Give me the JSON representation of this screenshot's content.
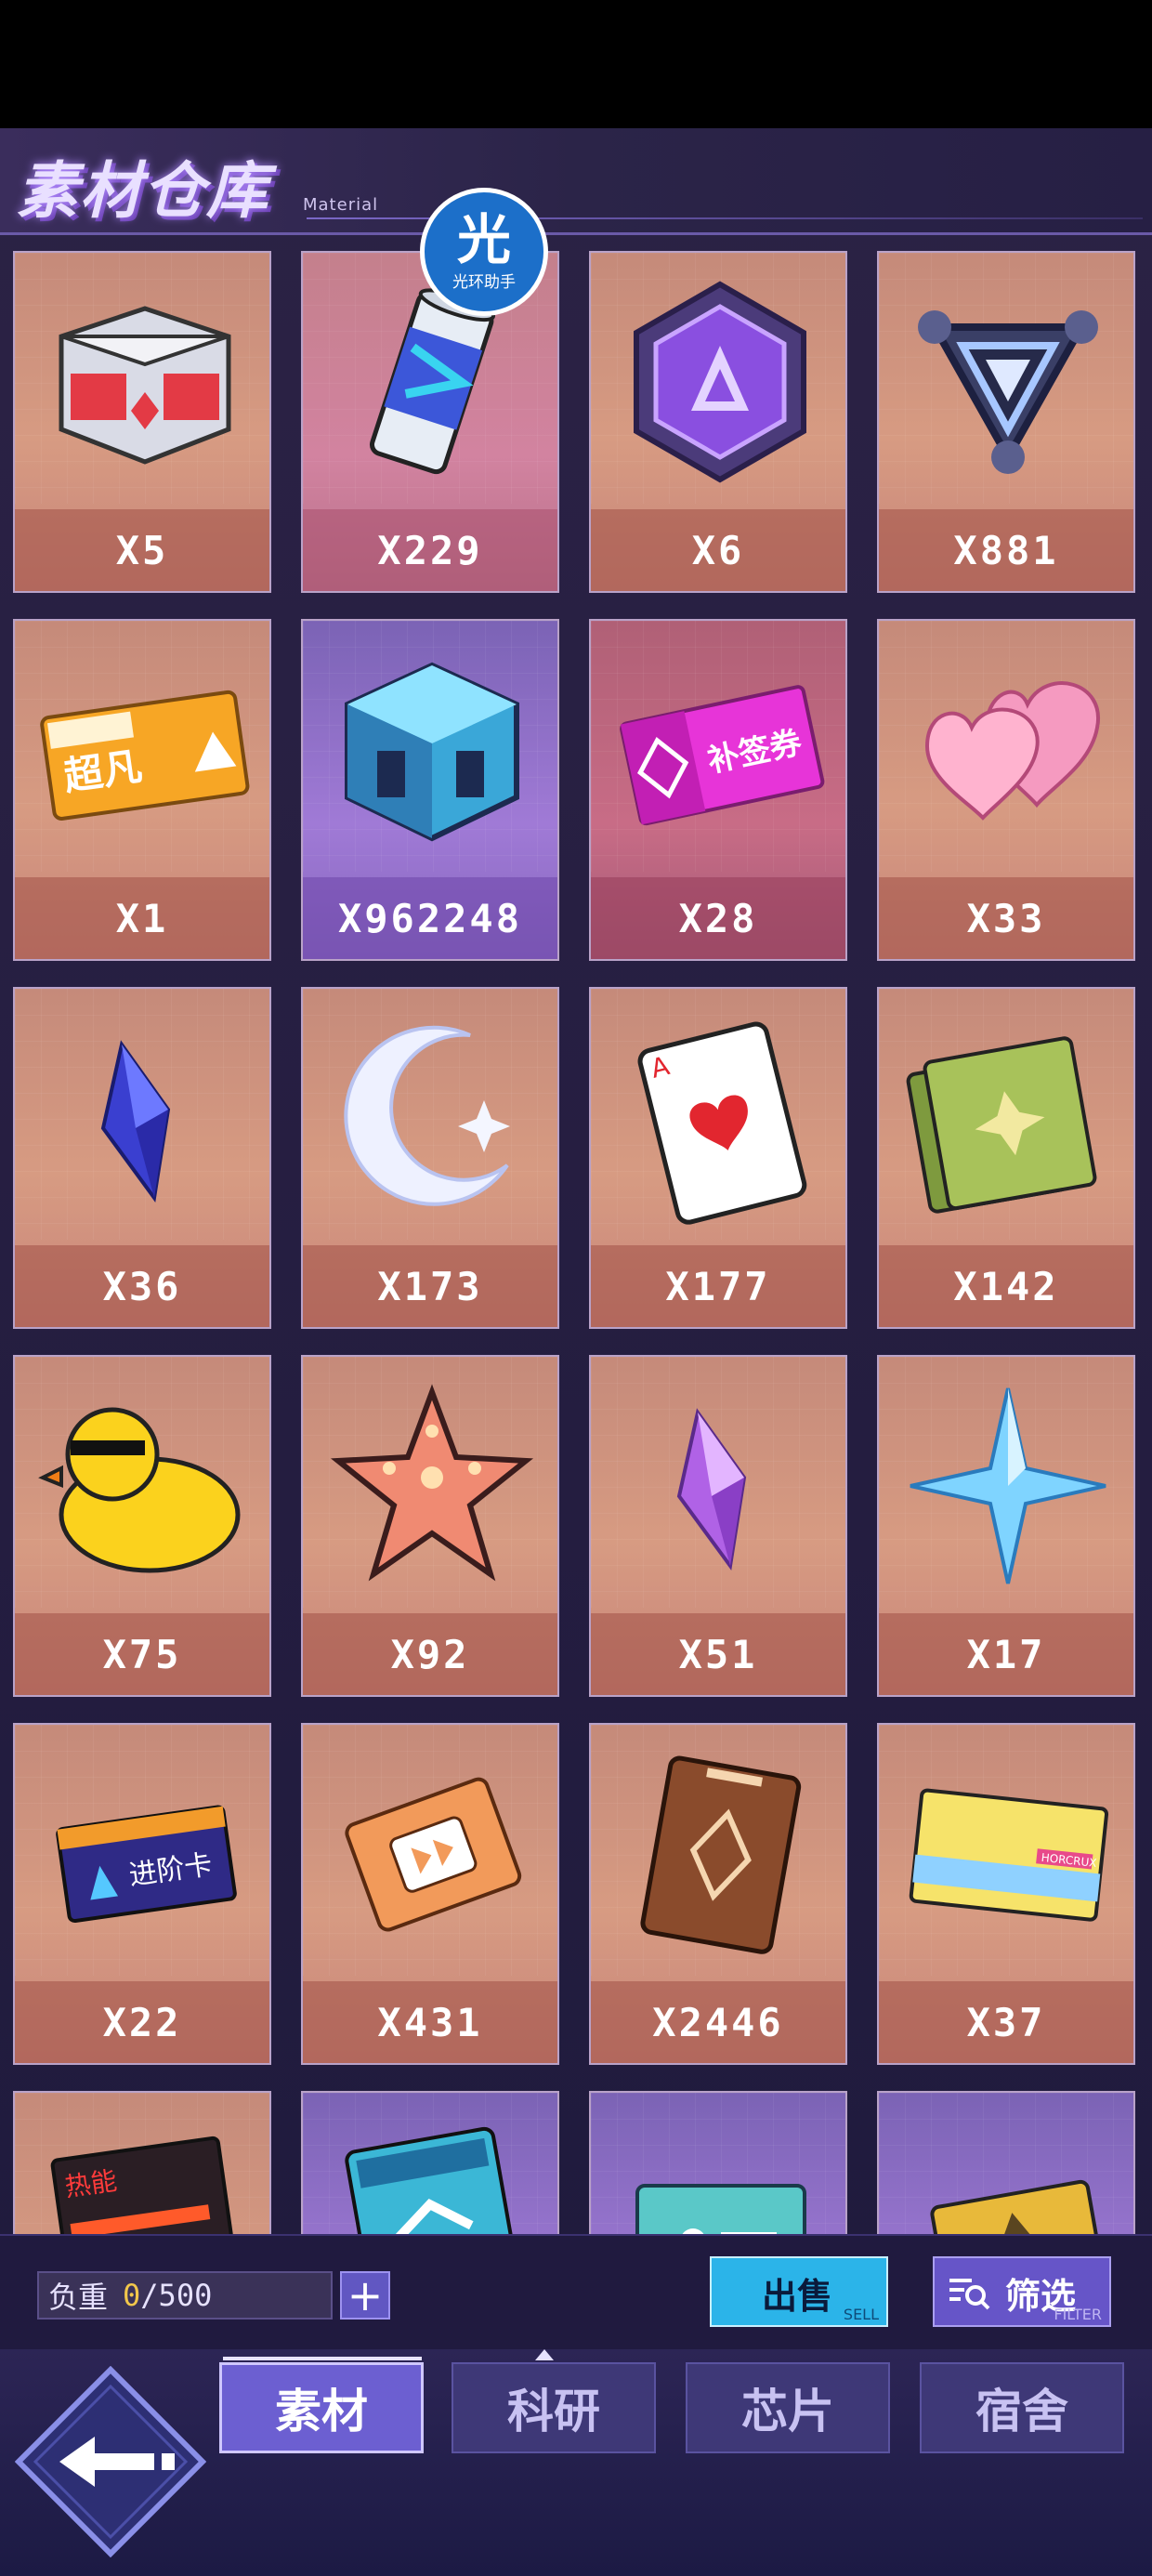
{
  "header": {
    "title": "素材仓库",
    "subtitle": "Material"
  },
  "watermark": {
    "char": "光",
    "text": "光环助手"
  },
  "items": [
    {
      "icon": "supply-crate-icon",
      "count": "X5",
      "tone": "orange"
    },
    {
      "icon": "energy-drink-can-icon",
      "count": "X229",
      "tone": "pink"
    },
    {
      "icon": "purple-hexagon-badge-icon",
      "count": "X6",
      "tone": "orange"
    },
    {
      "icon": "triangle-core-icon",
      "count": "X881",
      "tone": "orange"
    },
    {
      "icon": "academy-ticket-icon",
      "count": "X1",
      "tone": "orange"
    },
    {
      "icon": "ice-cube-icon",
      "count": "X962248",
      "tone": "purple"
    },
    {
      "icon": "makeup-ticket-icon",
      "count": "X28",
      "tone": "magenta"
    },
    {
      "icon": "pink-hearts-icon",
      "count": "X33",
      "tone": "orange"
    },
    {
      "icon": "blue-crystal-icon",
      "count": "X36",
      "tone": "orange"
    },
    {
      "icon": "crescent-moon-icon",
      "count": "X173",
      "tone": "orange"
    },
    {
      "icon": "ace-of-hearts-card-icon",
      "count": "X177",
      "tone": "orange"
    },
    {
      "icon": "green-card-stack-icon",
      "count": "X142",
      "tone": "orange"
    },
    {
      "icon": "rubber-duck-icon",
      "count": "X75",
      "tone": "orange"
    },
    {
      "icon": "starfish-icon",
      "count": "X92",
      "tone": "orange"
    },
    {
      "icon": "purple-crystal-icon",
      "count": "X51",
      "tone": "orange"
    },
    {
      "icon": "blue-star-shard-icon",
      "count": "X17",
      "tone": "orange"
    },
    {
      "icon": "access-card-icon",
      "count": "X22",
      "tone": "orange"
    },
    {
      "icon": "orange-chip-card-icon",
      "count": "X431",
      "tone": "orange"
    },
    {
      "icon": "brown-rune-card-icon",
      "count": "X2446",
      "tone": "orange"
    },
    {
      "icon": "horcrux-ticket-icon",
      "count": "X37",
      "tone": "orange"
    },
    {
      "icon": "hot-energy-card-icon",
      "count": "",
      "tone": "orange"
    },
    {
      "icon": "agreement-card-icon",
      "count": "",
      "tone": "purple"
    },
    {
      "icon": "teal-chip-card-icon",
      "count": "",
      "tone": "purple"
    },
    {
      "icon": "gold-card-icon",
      "count": "",
      "tone": "purple"
    }
  ],
  "footer": {
    "weight_label": "负重",
    "weight_current": "0",
    "weight_max": "/500",
    "plus_label": "+",
    "sell_label": "出售",
    "sell_sub": "SELL",
    "filter_label": "筛选",
    "filter_sub": "FILTER"
  },
  "tabs": [
    {
      "label": "素材",
      "active": true
    },
    {
      "label": "科研",
      "active": false
    },
    {
      "label": "芯片",
      "active": false
    },
    {
      "label": "宿舍",
      "active": false
    }
  ],
  "colors": {
    "accent": "#6c5fd1",
    "sell": "#2bb4e9",
    "weight_value": "#f2c74b"
  }
}
